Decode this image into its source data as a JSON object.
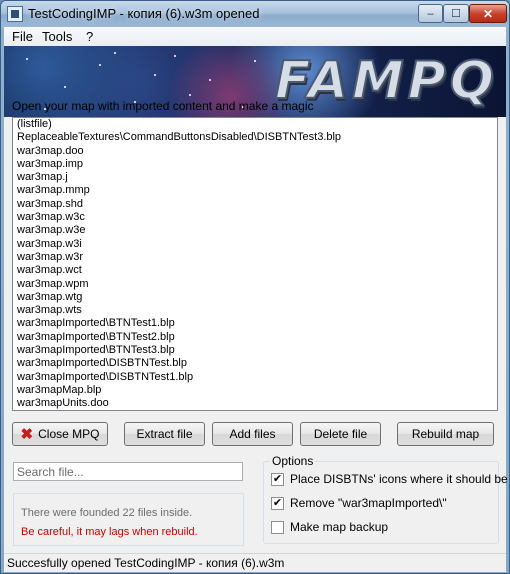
{
  "window": {
    "title": "TestCodingIMP - копия (6).w3m opened"
  },
  "title_buttons": {
    "minimize": "–",
    "maximize": "☐",
    "close": "✕"
  },
  "menu": {
    "items": [
      "File",
      "Tools",
      "?"
    ]
  },
  "banner": {
    "logo_text": "FAMPQ"
  },
  "instruction": "Open your map with imported content and make a magic",
  "files": [
    "(listfile)",
    "ReplaceableTextures\\CommandButtonsDisabled\\DISBTNTest3.blp",
    "war3map.doo",
    "war3map.imp",
    "war3map.j",
    "war3map.mmp",
    "war3map.shd",
    "war3map.w3c",
    "war3map.w3e",
    "war3map.w3i",
    "war3map.w3r",
    "war3map.wct",
    "war3map.wpm",
    "war3map.wtg",
    "war3map.wts",
    "war3mapImported\\BTNTest1.blp",
    "war3mapImported\\BTNTest2.blp",
    "war3mapImported\\BTNTest3.blp",
    "war3mapImported\\DISBTNTest.blp",
    "war3mapImported\\DISBTNTest1.blp",
    "war3mapMap.blp",
    "war3mapUnits.doo"
  ],
  "buttons": {
    "close_mpq": "Close MPQ",
    "extract_file": "Extract file",
    "add_files": "Add files",
    "delete_file": "Delete file",
    "rebuild_map": "Rebuild map"
  },
  "search": {
    "placeholder": "Search file..."
  },
  "info": {
    "count_text": "There were founded 22 files inside.",
    "warning_text": "Be careful, it may lags when rebuild.",
    "warning_color": "#cc0000"
  },
  "options": {
    "legend": "Options",
    "items": [
      {
        "label": "Place DISBTNs' icons where it should be",
        "checked": true
      },
      {
        "label": "Remove \"war3mapImported\\\"",
        "checked": true
      },
      {
        "label": "Make map backup",
        "checked": false
      }
    ]
  },
  "status": "Succesfully opened TestCodingIMP - копия (6).w3m"
}
